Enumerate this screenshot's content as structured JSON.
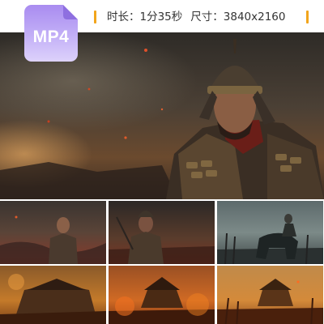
{
  "badge": {
    "label": "MP4",
    "icon": "video-file-icon",
    "color": "#a98cf0"
  },
  "info": {
    "duration": "时长：1分35秒",
    "size": "尺寸：3840x2160",
    "accent_color": "#f2a51c"
  },
  "preview": {
    "thumbnails": [
      {
        "id": "t1"
      },
      {
        "id": "t2"
      },
      {
        "id": "t3"
      },
      {
        "id": "t4"
      },
      {
        "id": "t5"
      },
      {
        "id": "t6"
      }
    ]
  }
}
